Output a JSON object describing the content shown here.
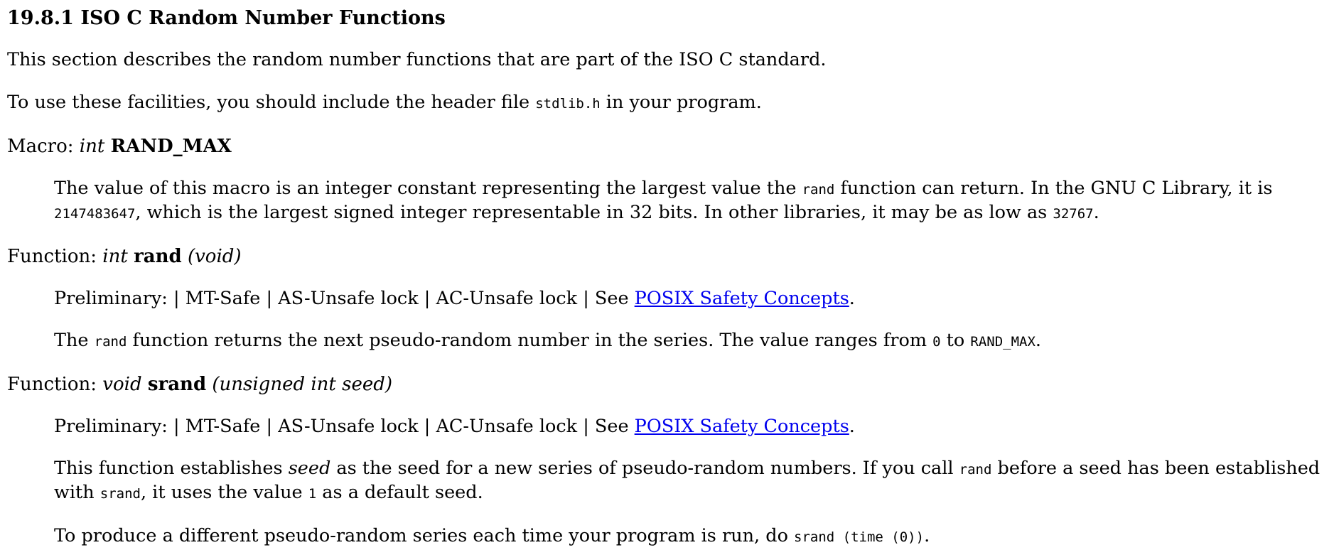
{
  "section": {
    "title": "19.8.1 ISO C Random Number Functions",
    "intro1": "This section describes the random number functions that are part of the ISO C standard.",
    "intro2_before": "To use these facilities, you should include the header file ",
    "intro2_code": "stdlib.h",
    "intro2_after": " in your program."
  },
  "rand_max": {
    "kind": "Macro: ",
    "type": "int",
    "name": "RAND_MAX",
    "desc_1": "The value of this macro is an integer constant representing the largest value the ",
    "desc_code1": "rand",
    "desc_2": " function can return. In the GNU C Library, it is ",
    "desc_code2": "2147483647",
    "desc_3": ", which is the largest signed integer representable in 32 bits. In other libraries, it may be as low as ",
    "desc_code3": "32767",
    "desc_4": "."
  },
  "rand": {
    "kind": "Function: ",
    "type": "int",
    "name": "rand",
    "args": "(void)",
    "safety_before": "Preliminary: | MT-Safe | AS-Unsafe lock | AC-Unsafe lock | See ",
    "safety_link": "POSIX Safety Concepts",
    "safety_after": ".",
    "desc_1": "The ",
    "desc_code1": "rand",
    "desc_2": " function returns the next pseudo-random number in the series. The value ranges from ",
    "desc_code2": "0",
    "desc_3": " to ",
    "desc_code3": "RAND_MAX",
    "desc_4": "."
  },
  "srand": {
    "kind": "Function: ",
    "type": "void",
    "name": "srand",
    "args": "(unsigned int seed)",
    "safety_before": "Preliminary: | MT-Safe | AS-Unsafe lock | AC-Unsafe lock | See ",
    "safety_link": "POSIX Safety Concepts",
    "safety_after": ".",
    "desc_1": "This function establishes ",
    "desc_em": "seed",
    "desc_2": " as the seed for a new series of pseudo-random numbers. If you call ",
    "desc_code1": "rand",
    "desc_3": " before a seed has been established with ",
    "desc_code2": "srand",
    "desc_4": ", it uses the value ",
    "desc_code3": "1",
    "desc_5": " as a default seed.",
    "tip_before": "To produce a different pseudo-random series each time your program is run, do ",
    "tip_code": "srand (time (0))",
    "tip_after": "."
  },
  "colors": {
    "text": "#000000",
    "link": "#0000ee",
    "background": "#ffffff"
  }
}
